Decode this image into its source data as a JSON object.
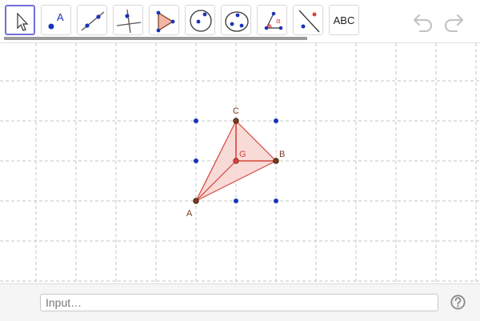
{
  "toolbar": {
    "tools": [
      {
        "id": "move",
        "icon": "cursor-arrow-icon"
      },
      {
        "id": "point",
        "icon": "point-tool-icon",
        "glyph_label": "A"
      },
      {
        "id": "line",
        "icon": "line-tool-icon"
      },
      {
        "id": "perpendicular",
        "icon": "perpendicular-line-icon"
      },
      {
        "id": "polygon",
        "icon": "polygon-tool-icon"
      },
      {
        "id": "circle",
        "icon": "circle-center-point-icon"
      },
      {
        "id": "conic",
        "icon": "circle-three-points-icon"
      },
      {
        "id": "angle",
        "icon": "angle-tool-icon",
        "glyph_label": "α"
      },
      {
        "id": "reflect",
        "icon": "reflect-about-line-icon"
      },
      {
        "id": "text",
        "label": "ABC"
      }
    ],
    "undo_icon": "undo-icon",
    "redo_icon": "redo-icon"
  },
  "graphics": {
    "points": {
      "A": "A",
      "B": "B",
      "C": "C",
      "G": "G"
    },
    "colors": {
      "point_dark": "#7a3b1e",
      "segment": "#d6453d",
      "fill": "#f7d6d3",
      "grid_dot": "#1a33bb",
      "grid_line": "#c4c4c4"
    }
  },
  "input": {
    "placeholder": "Input…"
  },
  "help_icon": "help-question-icon"
}
